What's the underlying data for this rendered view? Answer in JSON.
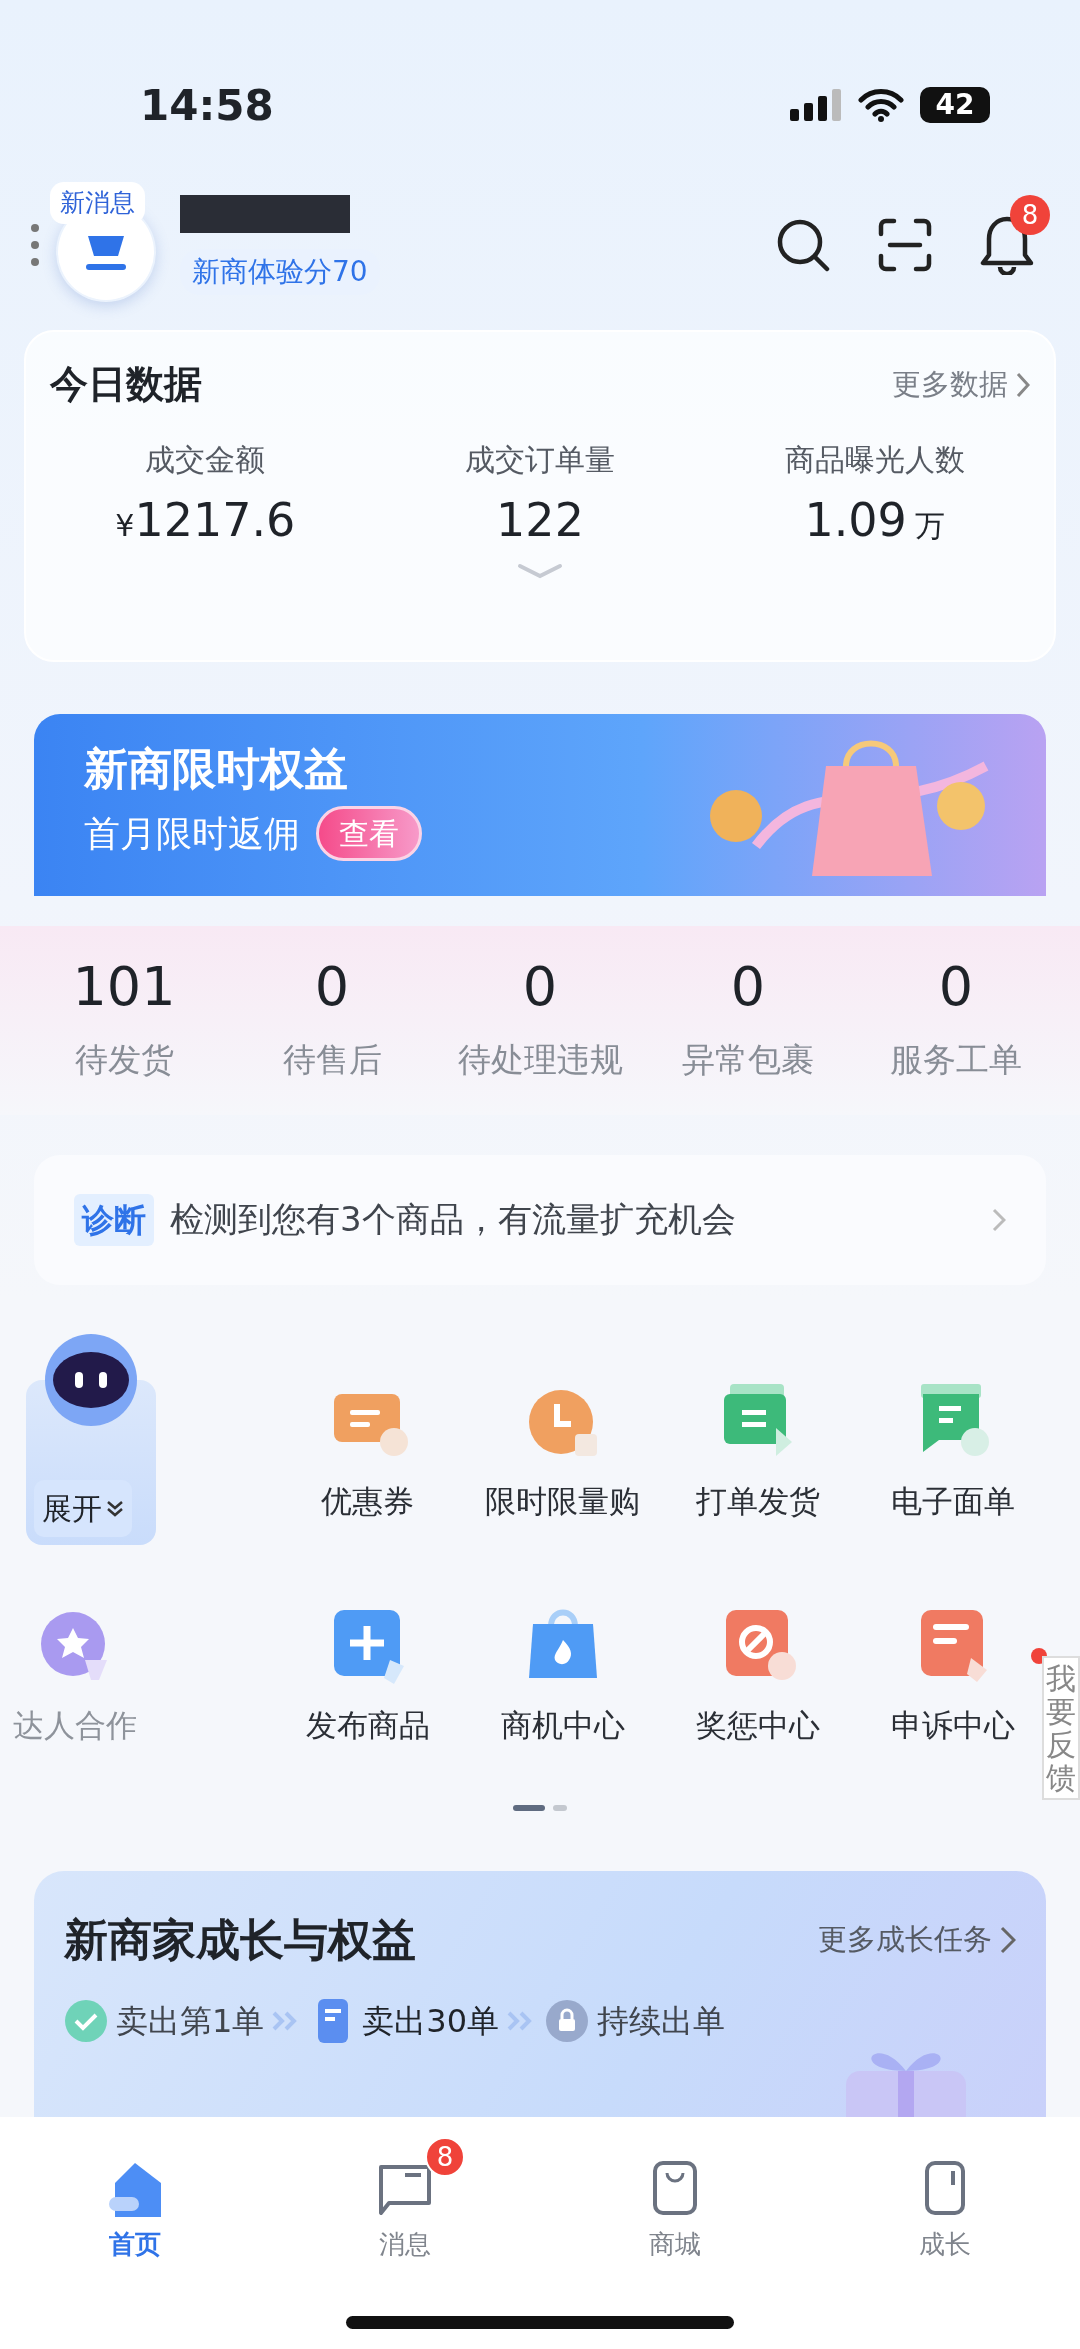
{
  "status_bar": {
    "time": "14:58",
    "battery": "42"
  },
  "header": {
    "new_message_badge": "新消息",
    "experience_score": "新商体验分70",
    "notification_count": "8"
  },
  "today_data": {
    "title": "今日数据",
    "more": "更多数据",
    "metrics": [
      {
        "label": "成交金额",
        "prefix": "¥",
        "value": "1217.6"
      },
      {
        "label": "成交订单量",
        "value": "122"
      },
      {
        "label": "商品曝光人数",
        "value": "1.09",
        "unit": "万"
      }
    ]
  },
  "banner": {
    "title": "新商限时权益",
    "subtitle": "首月限时返佣",
    "button": "查看"
  },
  "order_stats": [
    {
      "count": "101",
      "label": "待发货"
    },
    {
      "count": "0",
      "label": "待售后"
    },
    {
      "count": "0",
      "label": "待处理违规"
    },
    {
      "count": "0",
      "label": "异常包裹"
    },
    {
      "count": "0",
      "label": "服务工单"
    }
  ],
  "diagnosis": {
    "tag": "诊断",
    "text": "检测到您有3个商品，有流量扩充机会"
  },
  "assistant": {
    "button": "展开"
  },
  "tools": [
    {
      "label": "优惠券",
      "color": "#f0a060",
      "disabled": false
    },
    {
      "label": "限时限量购",
      "color": "#f0a060",
      "disabled": false
    },
    {
      "label": "打单发货",
      "color": "#3dba7a",
      "disabled": false
    },
    {
      "label": "电子面单",
      "color": "#3dba7a",
      "disabled": false
    },
    {
      "label": "达人合作",
      "color": "#a99af0",
      "disabled": true
    },
    {
      "label": "发布商品",
      "color": "#4f9bf5",
      "disabled": false
    },
    {
      "label": "商机中心",
      "color": "#4f9bf5",
      "disabled": false
    },
    {
      "label": "奖惩中心",
      "color": "#f07a62",
      "disabled": false
    },
    {
      "label": "申诉中心",
      "color": "#f07a62",
      "disabled": false
    }
  ],
  "pager": [
    {
      "selected": true
    },
    {
      "selected": false
    }
  ],
  "feedback": {
    "label": "我要反馈"
  },
  "growth": {
    "title": "新商家成长与权益",
    "more": "更多成长任务",
    "steps": [
      {
        "label": "卖出第1单",
        "kind": "done"
      },
      {
        "label": "卖出30单",
        "kind": "current"
      },
      {
        "label": "持续出单",
        "kind": "locked"
      }
    ]
  },
  "bottom_nav": [
    {
      "label": "首页",
      "selected": true
    },
    {
      "label": "消息",
      "selected": false,
      "badge": "8"
    },
    {
      "label": "商城",
      "selected": false
    },
    {
      "label": "成长",
      "selected": false
    }
  ]
}
